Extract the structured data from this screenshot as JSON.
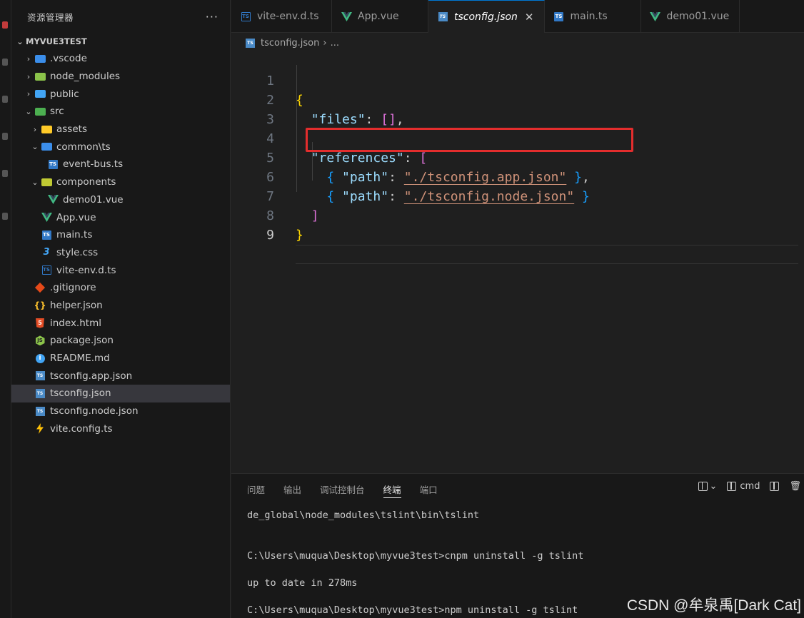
{
  "sidebar": {
    "title": "资源管理器",
    "more": "···",
    "project": "MYVUE3TEST",
    "tree": [
      {
        "label": ".vscode",
        "depth": 0,
        "twisty": "›",
        "icon": "vscode-folder-icon",
        "color": "#3b8eea"
      },
      {
        "label": "node_modules",
        "depth": 0,
        "twisty": "›",
        "icon": "node-modules-folder-icon",
        "color": "#8bc34a"
      },
      {
        "label": "public",
        "depth": 0,
        "twisty": "›",
        "icon": "globe-folder-icon",
        "color": "#42a5f5"
      },
      {
        "label": "src",
        "depth": 0,
        "twisty": "⌄",
        "icon": "src-folder-icon",
        "color": "#4caf50"
      },
      {
        "label": "assets",
        "depth": 1,
        "twisty": "›",
        "icon": "assets-folder-icon",
        "color": "#ffca28"
      },
      {
        "label": "common\\ts",
        "depth": 1,
        "twisty": "⌄",
        "icon": "ts-folder-icon",
        "color": "#3b8eea"
      },
      {
        "label": "event-bus.ts",
        "depth": 2,
        "twisty": "",
        "icon": "typescript-file-icon",
        "color": "#3178c6"
      },
      {
        "label": "components",
        "depth": 1,
        "twisty": "⌄",
        "icon": "components-folder-icon",
        "color": "#c0ca33"
      },
      {
        "label": "demo01.vue",
        "depth": 2,
        "twisty": "",
        "icon": "vue-file-icon",
        "color": "#41b883"
      },
      {
        "label": "App.vue",
        "depth": 1,
        "twisty": "",
        "icon": "vue-file-icon",
        "color": "#41b883"
      },
      {
        "label": "main.ts",
        "depth": 1,
        "twisty": "",
        "icon": "typescript-file-icon",
        "color": "#3178c6"
      },
      {
        "label": "style.css",
        "depth": 1,
        "twisty": "",
        "icon": "css-file-icon",
        "color": "#42a5f5"
      },
      {
        "label": "vite-env.d.ts",
        "depth": 1,
        "twisty": "",
        "icon": "typescript-def-file-icon",
        "color": "#3178c6"
      },
      {
        "label": ".gitignore",
        "depth": 0,
        "twisty": "",
        "icon": "git-file-icon",
        "color": "#e64a19"
      },
      {
        "label": "helper.json",
        "depth": 0,
        "twisty": "",
        "icon": "json-braces-icon",
        "color": "#fbc02d"
      },
      {
        "label": "index.html",
        "depth": 0,
        "twisty": "",
        "icon": "html-file-icon",
        "color": "#e44d26"
      },
      {
        "label": "package.json",
        "depth": 0,
        "twisty": "",
        "icon": "node-js-file-icon",
        "color": "#8bc34a"
      },
      {
        "label": "README.md",
        "depth": 0,
        "twisty": "",
        "icon": "info-icon",
        "color": "#42a5f5"
      },
      {
        "label": "tsconfig.app.json",
        "depth": 0,
        "twisty": "",
        "icon": "tsconfig-file-icon",
        "color": "#4a8ac6"
      },
      {
        "label": "tsconfig.json",
        "depth": 0,
        "twisty": "",
        "icon": "tsconfig-file-icon",
        "color": "#4a8ac6",
        "selected": true
      },
      {
        "label": "tsconfig.node.json",
        "depth": 0,
        "twisty": "",
        "icon": "tsconfig-file-icon",
        "color": "#4a8ac6"
      },
      {
        "label": "vite.config.ts",
        "depth": 0,
        "twisty": "",
        "icon": "vite-bolt-icon",
        "color": "#ffc107"
      }
    ]
  },
  "tabs": [
    {
      "label": "vite-env.d.ts",
      "icon": "typescript-def-file-icon"
    },
    {
      "label": "App.vue",
      "icon": "vue-file-icon"
    },
    {
      "label": "tsconfig.json",
      "icon": "tsconfig-file-icon",
      "active": true
    },
    {
      "label": "main.ts",
      "icon": "typescript-file-icon"
    },
    {
      "label": "demo01.vue",
      "icon": "vue-file-icon"
    }
  ],
  "tab_close": "✕",
  "breadcrumb": {
    "file": "tsconfig.json",
    "sep": "›",
    "rest": "..."
  },
  "code": {
    "line_numbers": [
      "1",
      "2",
      "3",
      "4",
      "5",
      "6",
      "7",
      "8",
      "9"
    ],
    "line1_brace": "{",
    "line2_key": "\"files\"",
    "line2_colon": ": ",
    "line2_value": "[]",
    "line2_comma": ",",
    "line4_key": "\"references\"",
    "line4_colon": ": ",
    "line4_bracket": "[",
    "line5_open": "{ ",
    "line5_key": "\"path\"",
    "line5_colon": ": ",
    "line5_value": "\"./tsconfig.app.json\"",
    "line5_close": " }",
    "line5_comma": ",",
    "line6_open": "{ ",
    "line6_key": "\"path\"",
    "line6_colon": ": ",
    "line6_value": "\"./tsconfig.node.json\"",
    "line6_close": " }",
    "line7_bracket": "]",
    "line8_brace": "}"
  },
  "panel": {
    "tabs": [
      "问题",
      "输出",
      "调试控制台",
      "终端",
      "端口"
    ],
    "active_tab": "终端",
    "shell_label": "cmd",
    "dropdown": "⌄",
    "trash": "🗑",
    "terminal_lines": [
      "de_global\\node_modules\\tslint\\bin\\tslint",
      "",
      "C:\\Users\\muqua\\Desktop\\myvue3test>cnpm uninstall -g tslint",
      "up to date in 278ms",
      "C:\\Users\\muqua\\Desktop\\myvue3test>npm uninstall -g tslint"
    ]
  },
  "watermark": "CSDN @牟泉禹[Dark Cat]",
  "colors": {
    "accent": "#0078d4",
    "highlight_box": "#e32d2d"
  }
}
